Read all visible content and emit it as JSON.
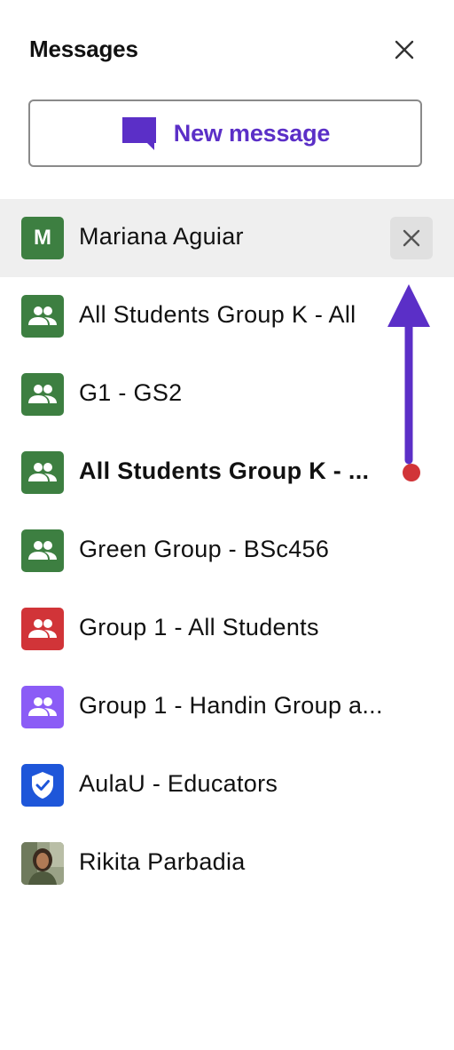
{
  "header": {
    "title": "Messages"
  },
  "new_message": {
    "label": "New message"
  },
  "colors": {
    "accent": "#5b2fc7",
    "green": "#3d7f41",
    "red": "#d13438",
    "purple": "#8b5cf6",
    "blue": "#1e56d9"
  },
  "conversations": [
    {
      "name": "Mariana Aguiar",
      "avatar": "initial",
      "initial": "M",
      "color": "#3d7f41",
      "active": true,
      "unread": false
    },
    {
      "name": "All Students Group K - All",
      "avatar": "group-icon",
      "color": "#3d7f41",
      "active": false,
      "unread": false
    },
    {
      "name": "G1 - GS2",
      "avatar": "group-icon",
      "color": "#3d7f41",
      "active": false,
      "unread": false
    },
    {
      "name": "All Students Group K - ...",
      "avatar": "group-icon",
      "color": "#3d7f41",
      "active": false,
      "unread": true
    },
    {
      "name": "Green Group - BSc456",
      "avatar": "group-icon",
      "color": "#3d7f41",
      "active": false,
      "unread": false
    },
    {
      "name": "Group 1 - All Students",
      "avatar": "group-icon",
      "color": "#d13438",
      "active": false,
      "unread": false
    },
    {
      "name": "Group 1 - Handin Group a...",
      "avatar": "group-icon",
      "color": "#8b5cf6",
      "active": false,
      "unread": false
    },
    {
      "name": "AulaU - Educators",
      "avatar": "shield-check-icon",
      "color": "#1e56d9",
      "active": false,
      "unread": false
    },
    {
      "name": "Rikita Parbadia",
      "avatar": "photo",
      "color": "#7d8a6a",
      "active": false,
      "unread": false
    }
  ]
}
